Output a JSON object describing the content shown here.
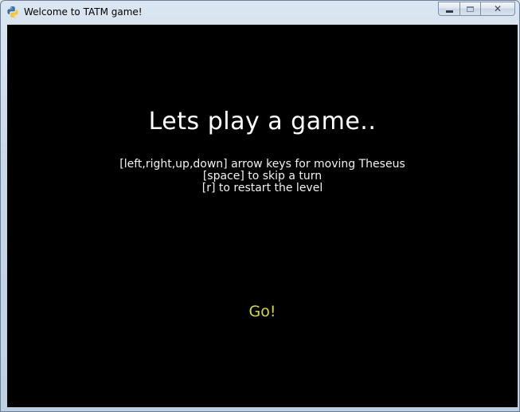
{
  "window": {
    "title": "Welcome to TATM game!",
    "app_icon": "python-icon",
    "controls": {
      "minimize_icon": "minimize-icon",
      "maximize_icon": "maximize-icon",
      "close_icon": "close-icon"
    }
  },
  "game": {
    "background_color": "#000000",
    "headline": "Lets play a game..",
    "instructions": [
      "[left,right,up,down] arrow keys for moving Theseus",
      "[space] to skip a turn",
      "[r] to restart the level"
    ],
    "go_label": "Go!",
    "go_color": "#d6d84a"
  }
}
